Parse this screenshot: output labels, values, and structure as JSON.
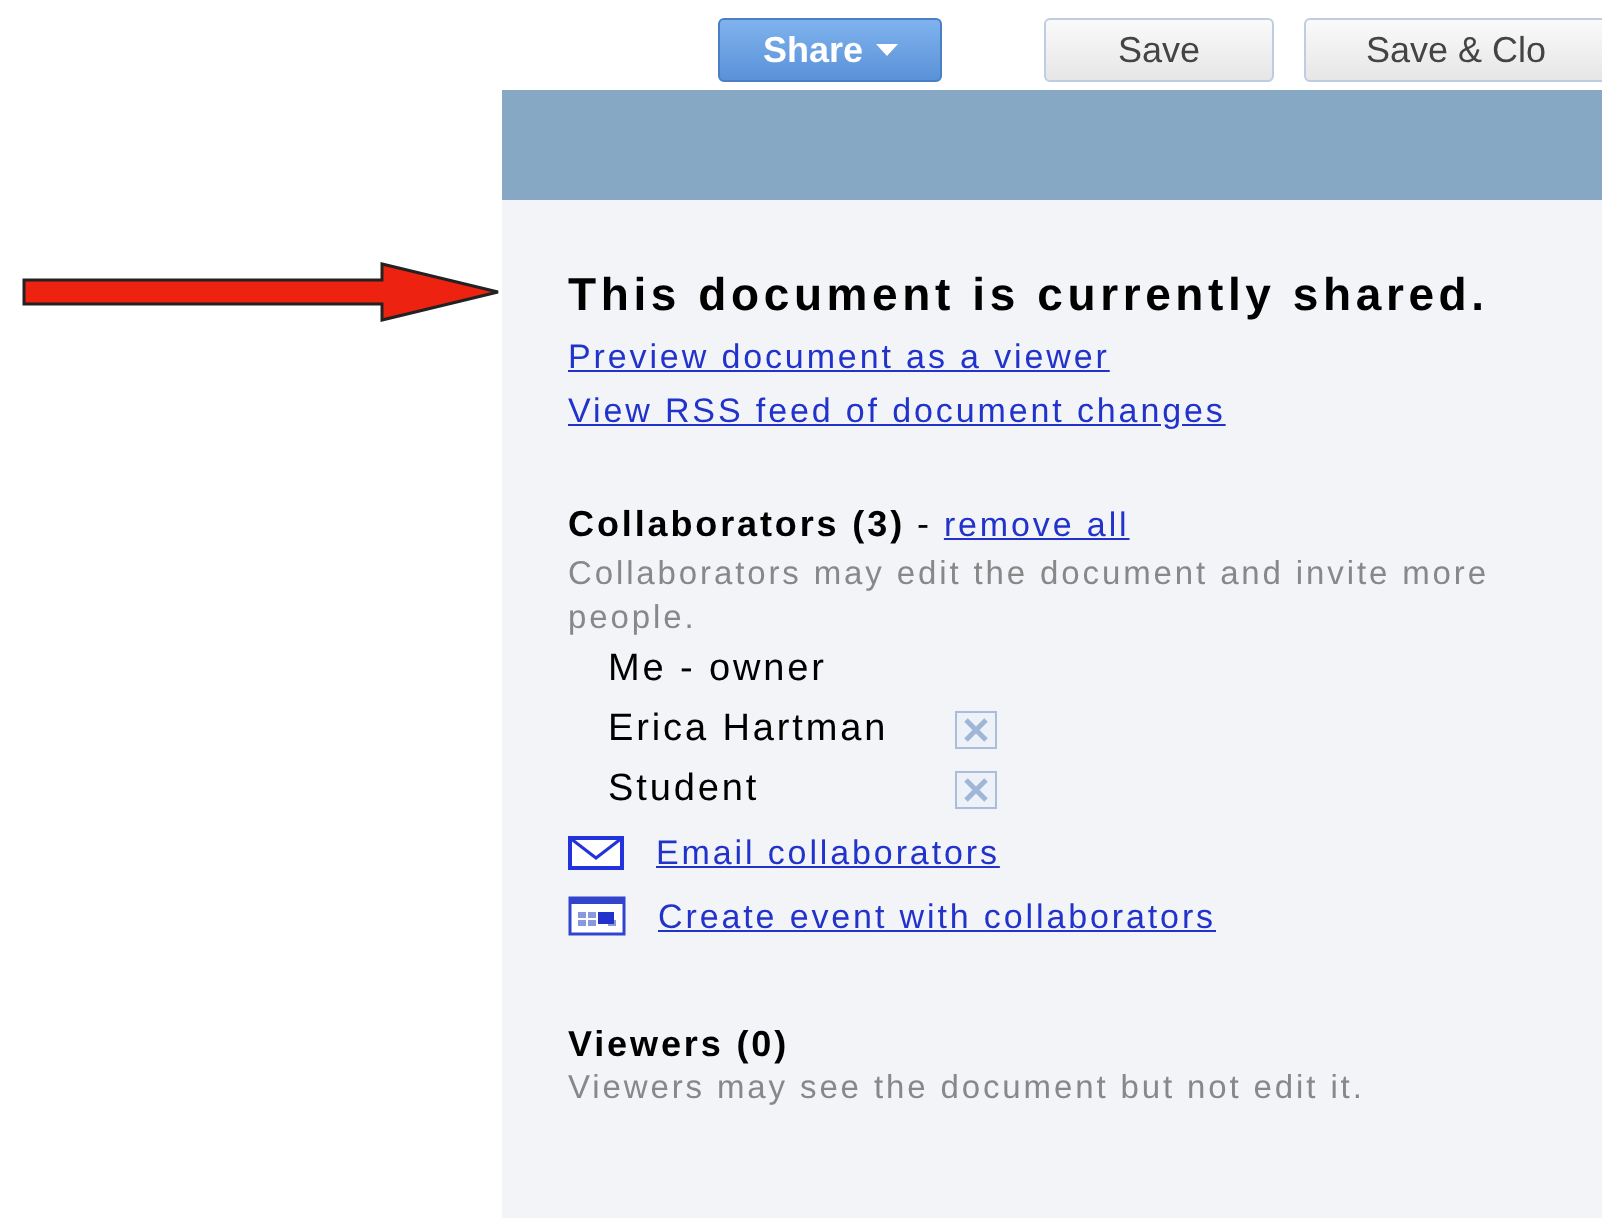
{
  "toolbar": {
    "buttons": [
      {
        "label": "Share",
        "kind": "menu"
      },
      {
        "label": "Save",
        "kind": "plain"
      },
      {
        "label": "Save & Clo",
        "kind": "plain"
      }
    ]
  },
  "panel": {
    "title": "This document is currently shared.",
    "links": [
      "Preview document as a viewer",
      "View RSS feed of document changes"
    ],
    "collaborators": {
      "heading": "Collaborators (3)",
      "separator": "-",
      "remove_all": "remove all",
      "description": "Collaborators may edit the document and invite more people.",
      "people": [
        {
          "name": "Me - owner",
          "removable": false
        },
        {
          "name": "Erica Hartman",
          "removable": true
        },
        {
          "name": "Student",
          "removable": true
        }
      ],
      "actions": [
        {
          "label": "Email collaborators",
          "kind": "email"
        },
        {
          "label": "Create event with collaborators",
          "kind": "calendar"
        }
      ]
    },
    "viewers": {
      "heading": "Viewers (0)",
      "description": "Viewers may see the document but not edit it."
    }
  }
}
